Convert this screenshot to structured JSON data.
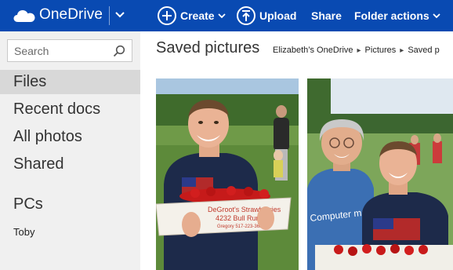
{
  "app": {
    "name": "OneDrive"
  },
  "toolbar": {
    "create_label": "Create",
    "upload_label": "Upload",
    "share_label": "Share",
    "folder_actions_label": "Folder actions"
  },
  "search": {
    "placeholder": "Search"
  },
  "sidebar": {
    "items": [
      {
        "label": "Files"
      },
      {
        "label": "Recent docs"
      },
      {
        "label": "All photos"
      },
      {
        "label": "Shared"
      }
    ],
    "pcs_heading": "PCs",
    "pcs": [
      {
        "label": "Toby"
      }
    ]
  },
  "main": {
    "title": "Saved pictures",
    "breadcrumb": [
      "Elizabeth’s OneDrive",
      "Pictures",
      "Saved p"
    ]
  },
  "photos": [
    {
      "box_text_1": "DeGroot's Strawberries",
      "box_text_2": "4232 Bull Run Rd",
      "box_text_3": "Gregory 517-223-3688"
    },
    {
      "shirt_text": "Computer ma"
    }
  ],
  "colors": {
    "brand_blue": "#094ab2",
    "nav_background": "#f0f0f0",
    "nav_active": "#d8d8d8"
  }
}
